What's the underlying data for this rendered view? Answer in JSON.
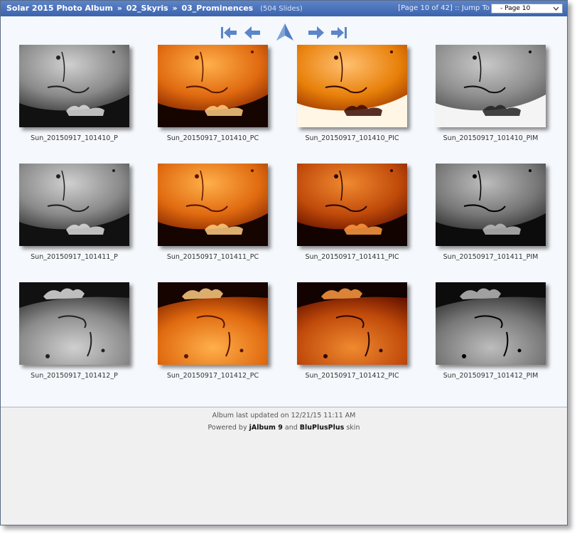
{
  "header": {
    "crumb_1": "Solar 2015 Photo Album",
    "crumb_2": "02_Skyris",
    "crumb_3": "03_Prominences",
    "sep": "»",
    "slide_count": "(504 Slides)",
    "page_info": "[Page 10 of 42] :: Jump To",
    "jump_value": "- Page 10"
  },
  "nav": {
    "first": "first-page-icon",
    "prev": "previous-page-icon",
    "up": "up-arrow-icon",
    "next": "next-page-icon",
    "last": "last-page-icon"
  },
  "thumbnails": [
    {
      "caption": "Sun_20150917_101410_P",
      "style": "gray"
    },
    {
      "caption": "Sun_20150917_101410_PC",
      "style": "orange"
    },
    {
      "caption": "Sun_20150917_101410_PIC",
      "style": "orange-inv"
    },
    {
      "caption": "Sun_20150917_101410_PIM",
      "style": "gray-inv"
    },
    {
      "caption": "Sun_20150917_101411_P",
      "style": "gray"
    },
    {
      "caption": "Sun_20150917_101411_PC",
      "style": "orange"
    },
    {
      "caption": "Sun_20150917_101411_PIC",
      "style": "orange-dark"
    },
    {
      "caption": "Sun_20150917_101411_PIM",
      "style": "gray-dark"
    },
    {
      "caption": "Sun_20150917_101412_P",
      "style": "gray"
    },
    {
      "caption": "Sun_20150917_101412_PC",
      "style": "orange"
    },
    {
      "caption": "Sun_20150917_101412_PIC",
      "style": "orange-dark"
    },
    {
      "caption": "Sun_20150917_101412_PIM",
      "style": "gray-dark"
    }
  ],
  "footer": {
    "updated": "Album last updated on 12/21/15 11:11 AM",
    "powered_prefix": "Powered by",
    "jalbum": "jAlbum 9",
    "and": "and",
    "skin": "BluPlusPlus",
    "skin_suffix": "skin"
  },
  "colors": {
    "header_bg": "#3b63ad",
    "content_bg": "#f5f8fc",
    "footer_bg": "#f0f0f0",
    "nav_arrow": "#5b86c8"
  }
}
